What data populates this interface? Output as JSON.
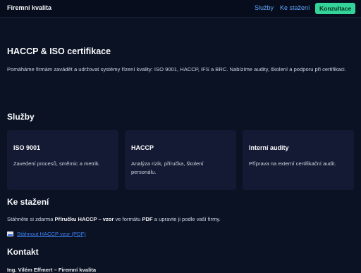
{
  "nav": {
    "brand": "Firemní kvalita",
    "links": [
      "Služby",
      "Ke stažení"
    ],
    "cta": "Konzultace"
  },
  "hero": {
    "title": "HACCP & ISO certifikace",
    "text": "Pomáháme firmám zavádět a udržovat systémy řízení kvality: ISO 9001, HACCP, IFS a BRC. Nabízíme audity, školení a podporu při certifikaci."
  },
  "services": {
    "heading": "Služby",
    "cards": [
      {
        "title": "ISO 9001",
        "text": "Zavedení procesů, směrnic a metrik."
      },
      {
        "title": "HACCP",
        "text": "Analýza rizik, příručka, školení personálu."
      },
      {
        "title": "Interní audity",
        "text": "Příprava na externí certifikační audit."
      }
    ]
  },
  "downloads": {
    "heading": "Ke stažení",
    "text_before": "Stáhněte si zdarma ",
    "text_bold1": "Příručku HACCP – vzor",
    "text_middle": " ve formátu ",
    "text_bold2": "PDF",
    "text_after": " a upravte ji podle vaší firmy.",
    "link_label": "Stáhnout HACCP vzor (PDF)"
  },
  "contact": {
    "heading": "Kontakt",
    "line": "Ing. Vilém Effmert – Firemní kvalita"
  }
}
